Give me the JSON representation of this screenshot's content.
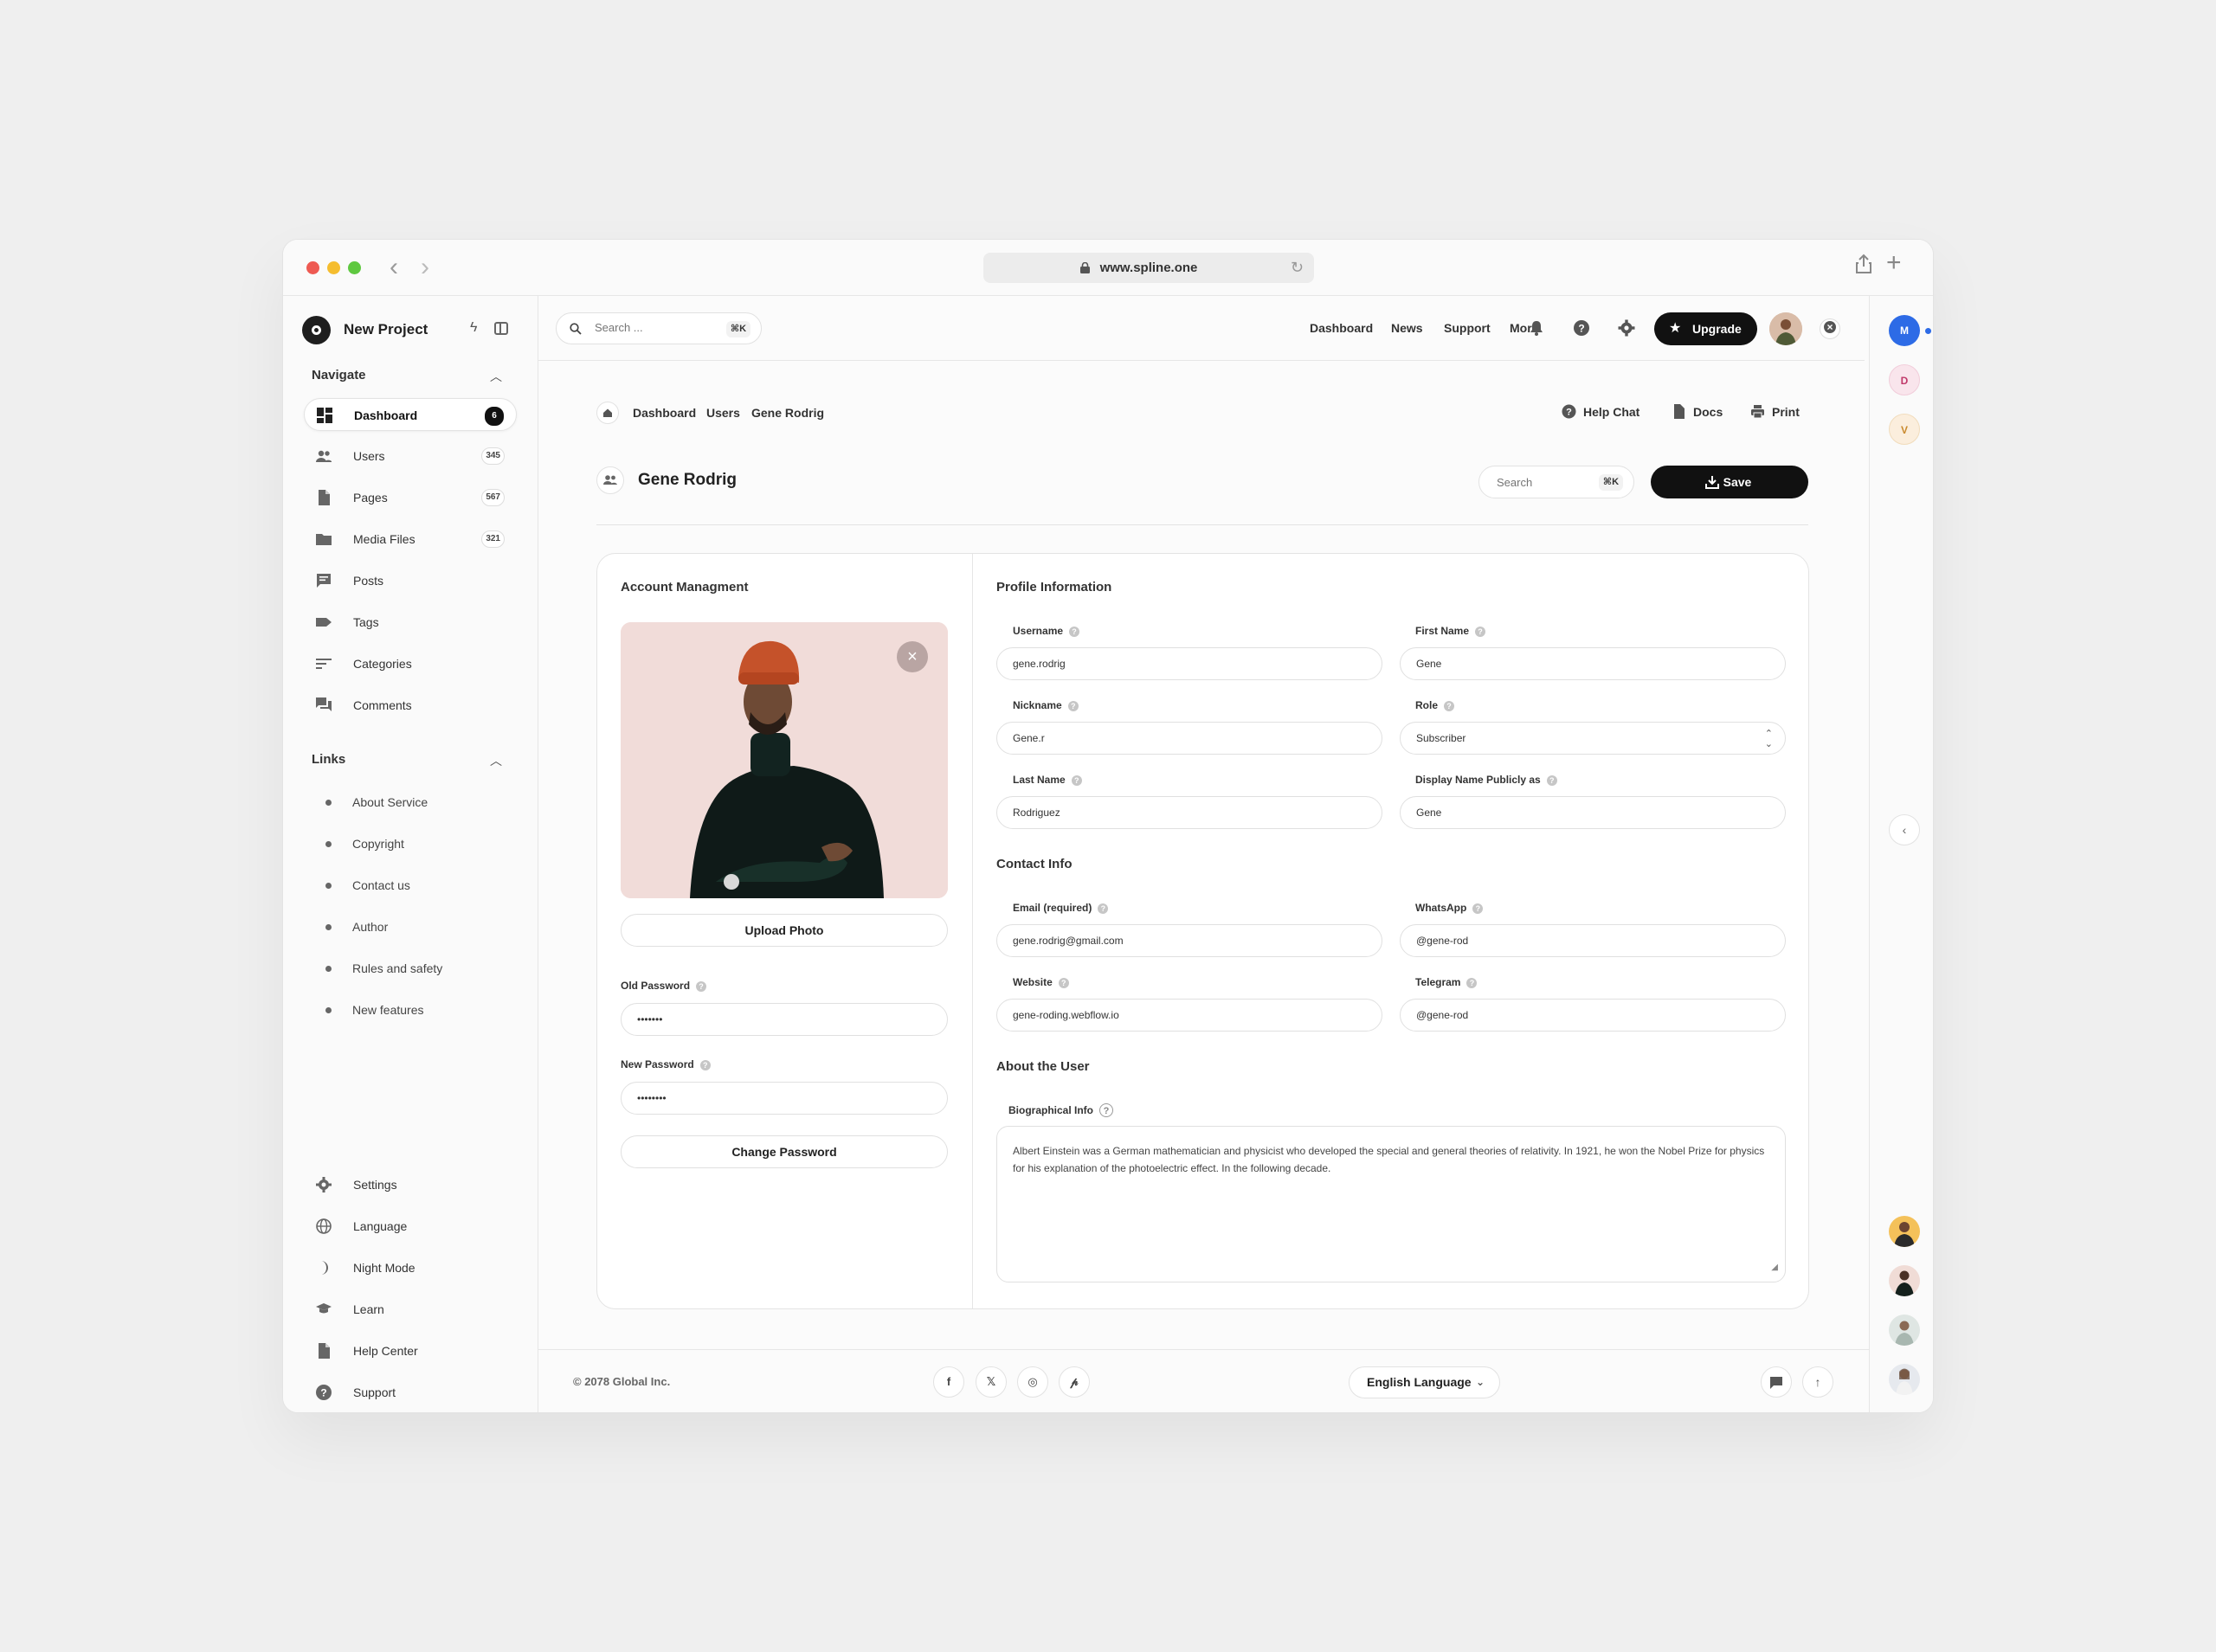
{
  "browser": {
    "url": "www.spline.one"
  },
  "brand": {
    "name": "New Project"
  },
  "navigate": {
    "heading": "Navigate",
    "items": [
      {
        "label": "Dashboard",
        "badge": "6",
        "icon": "dashboard-icon"
      },
      {
        "label": "Users",
        "badge": "345",
        "icon": "users-icon"
      },
      {
        "label": "Pages",
        "badge": "567",
        "icon": "page-icon"
      },
      {
        "label": "Media Files",
        "badge": "321",
        "icon": "folder-icon"
      },
      {
        "label": "Posts",
        "badge": "",
        "icon": "chat-icon"
      },
      {
        "label": "Tags",
        "badge": "",
        "icon": "tag-icon"
      },
      {
        "label": "Categories",
        "badge": "",
        "icon": "list-icon"
      },
      {
        "label": "Comments",
        "badge": "",
        "icon": "comments-icon"
      }
    ]
  },
  "links": {
    "heading": "Links",
    "items": [
      "About Service",
      "Copyright",
      "Contact us",
      "Author",
      "Rules and safety",
      "New features"
    ]
  },
  "bottom_nav": {
    "items": [
      {
        "label": "Settings",
        "icon": "gear-icon"
      },
      {
        "label": "Language",
        "icon": "globe-icon"
      },
      {
        "label": "Night Mode",
        "icon": "moon-icon"
      },
      {
        "label": "Learn",
        "icon": "graduation-cap-icon"
      },
      {
        "label": "Help Center",
        "icon": "document-icon"
      },
      {
        "label": "Support",
        "icon": "help-circle-icon"
      }
    ]
  },
  "topbar": {
    "search_placeholder": "Search ...",
    "search_shortcut": "⌘K",
    "nav": [
      "Dashboard",
      "News",
      "Support",
      "More"
    ],
    "upgrade_label": "Upgrade"
  },
  "breadcrumb": [
    "Dashboard",
    "Users",
    "Gene Rodrig"
  ],
  "page_actions": {
    "help_chat": "Help Chat",
    "docs": "Docs",
    "print": "Print"
  },
  "page": {
    "title": "Gene Rodrig",
    "search_placeholder": "Search",
    "search_shortcut": "⌘K",
    "save_label": "Save"
  },
  "account": {
    "heading": "Account Managment",
    "upload_label": "Upload Photo",
    "old_password_label": "Old Password",
    "old_password_value": "•••••••",
    "new_password_label": "New Password",
    "new_password_value": "••••••••",
    "change_password_label": "Change Password"
  },
  "profile": {
    "heading": "Profile Information",
    "username_label": "Username",
    "username": "gene.rodrig",
    "first_name_label": "First Name",
    "first_name": "Gene",
    "nickname_label": "Nickname",
    "nickname": "Gene.r",
    "role_label": "Role",
    "role": "Subscriber",
    "last_name_label": "Last Name",
    "last_name": "Rodriguez",
    "display_name_label": "Display Name Publicly as",
    "display_name": "Gene"
  },
  "contact": {
    "heading": "Contact Info",
    "email_label": "Email (required)",
    "email": "gene.rodrig@gmail.com",
    "whatsapp_label": "WhatsApp",
    "whatsapp": "@gene-rod",
    "website_label": "Website",
    "website": "gene-roding.webflow.io",
    "telegram_label": "Telegram",
    "telegram": "@gene-rod"
  },
  "about": {
    "heading": "About the User",
    "bio_label": "Biographical Info",
    "bio": "Albert Einstein was a German mathematician and physicist who developed the special and general theories of relativity. In 1921, he won the Nobel Prize for physics for his explanation of the photoelectric effect. In the following decade."
  },
  "footer": {
    "copyright": "© 2078 Global Inc.",
    "social": [
      "f",
      "𝕏",
      "◎",
      "𝓅"
    ],
    "language": "English Language"
  },
  "right_rail": {
    "avatars": [
      {
        "letter": "M",
        "bg": "#2d6be6",
        "fg": "#ffffff"
      },
      {
        "letter": "D",
        "bg": "#f9e5ec",
        "fg": "#c0396a"
      },
      {
        "letter": "V",
        "bg": "#fbeedd",
        "fg": "#c98a2e"
      }
    ]
  },
  "colors": {
    "accent": "#111111",
    "mac_red": "#ee5a52",
    "mac_yellow": "#f5bd2f",
    "mac_green": "#5fc840"
  }
}
